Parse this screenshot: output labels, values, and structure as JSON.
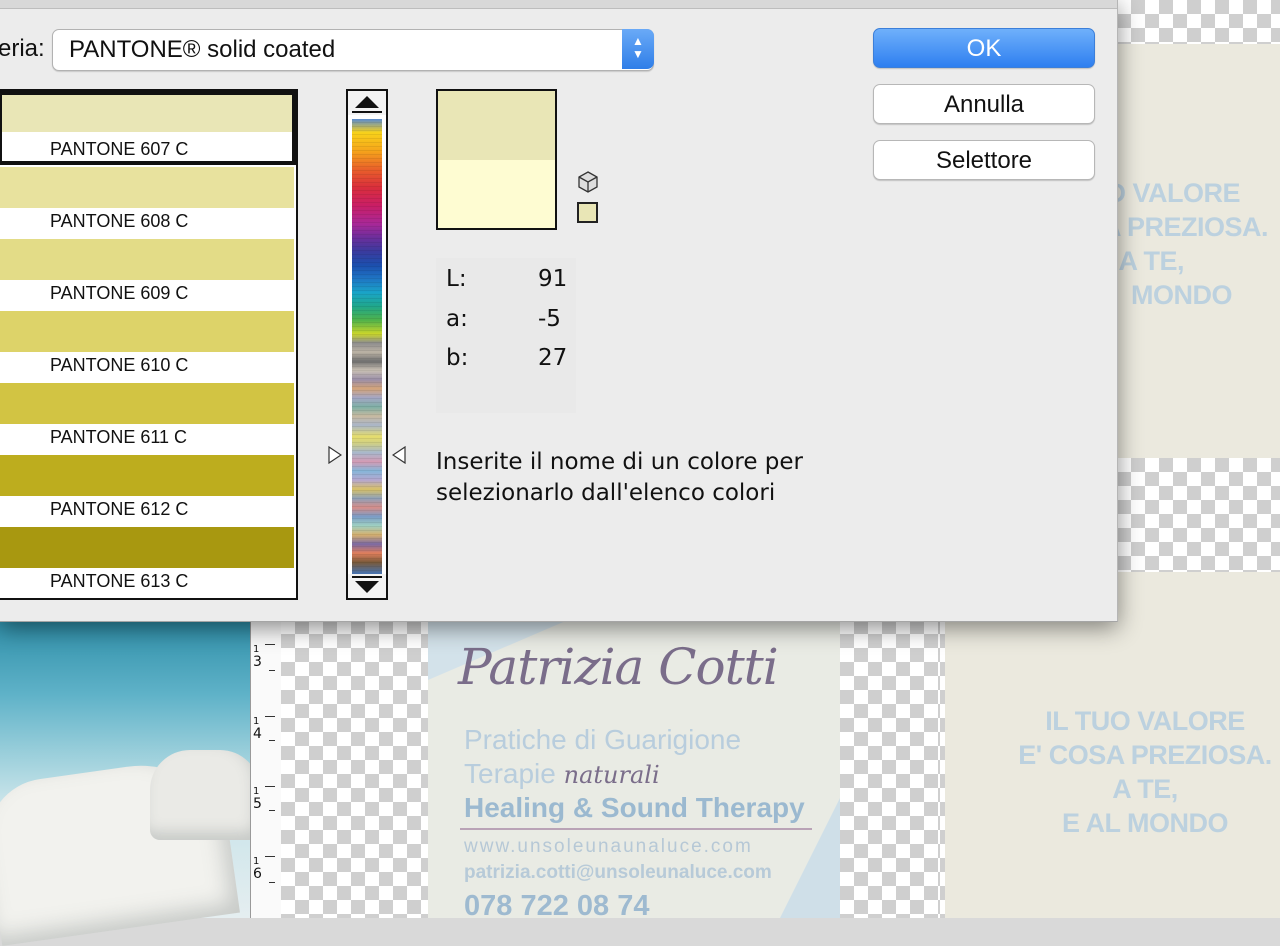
{
  "dialog": {
    "library_label": "eria:",
    "library_value": "PANTONE® solid coated",
    "buttons": {
      "ok": "OK",
      "cancel": "Annulla",
      "picker": "Selettore"
    },
    "swatches": [
      {
        "name": "PANTONE 607 C",
        "color": "#e9e6b6",
        "selected": true
      },
      {
        "name": "PANTONE 608 C",
        "color": "#e8e29e"
      },
      {
        "name": "PANTONE 609 C",
        "color": "#e3dc87"
      },
      {
        "name": "PANTONE 610 C",
        "color": "#ddd369"
      },
      {
        "name": "PANTONE 611 C",
        "color": "#d2c443"
      },
      {
        "name": "PANTONE 612 C",
        "color": "#bdad1e"
      },
      {
        "name": "PANTONE 613 C",
        "color": "#a89810"
      }
    ],
    "preview": {
      "new_color": "#e9e6b6",
      "current_color": "#fefcd2"
    },
    "lab": {
      "L_label": "L:",
      "L": "91",
      "a_label": "a:",
      "a": "-5",
      "b_label": "b:",
      "b": "27"
    },
    "hint": "Inserite il nome di un colore per selezionarlo dall'elenco colori",
    "icons": [
      "cube-icon",
      "color-swatch-icon",
      "scroll-up-icon",
      "scroll-down-icon",
      "slider-left-arrow-icon",
      "slider-right-arrow-icon",
      "select-arrows-icon"
    ]
  },
  "document": {
    "slogan_partial": [
      "D VALORE",
      "A PREZIOSA.",
      "A TE,",
      "MONDO"
    ],
    "slogan": [
      "IL TUO VALORE",
      "E' COSA PREZIOSA.",
      "A TE,",
      "E AL MONDO"
    ],
    "card": {
      "signature": "Patrizia Cotti",
      "line1": "Pratiche di Guarigione",
      "line2a": "Terapie",
      "line2b": "naturali",
      "line3": "Healing & Sound Therapy",
      "web": "www.unsoleunaunaluce.com",
      "email": "patrizia.cotti@unsoleunaluce.com",
      "phone": "078 722 08 74"
    },
    "ruler_marks": [
      "3",
      "4",
      "5",
      "6"
    ]
  }
}
